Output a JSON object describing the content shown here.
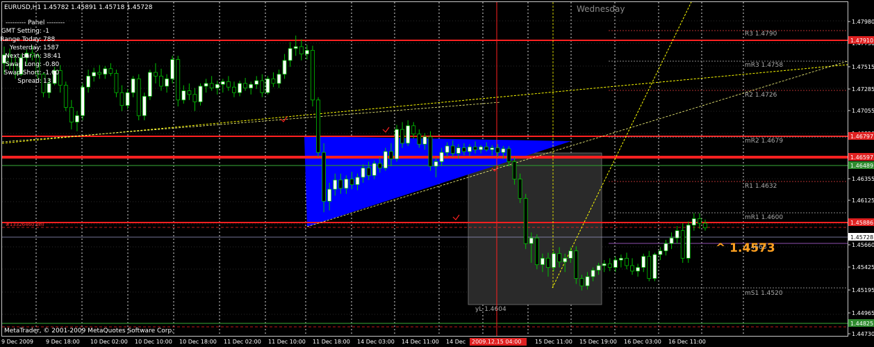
{
  "header": {
    "symbol_info": "EURUSD,H1  1.45782 1.45891 1.45718 1.45728",
    "day_label": "Wednesday"
  },
  "panel": {
    "title": "---------  Panel  --------",
    "rows": [
      {
        "label": "GMT Setting:",
        "value": "-1"
      },
      {
        "label": "Range Today:",
        "value": "788"
      },
      {
        "label": "Yesterday:",
        "value": "1587"
      },
      {
        "label": "Next bar in:",
        "value": "38:41"
      },
      {
        "label": "Swap Long:",
        "value": "-0.80"
      },
      {
        "label": "Swap Short:",
        "value": "-1.60"
      },
      {
        "label": "Spread:",
        "value": "13"
      }
    ]
  },
  "levels": [
    {
      "label": "R3 1.4790",
      "price": 1.479,
      "style": "dotted-red"
    },
    {
      "label": "mR3 1.4758",
      "price": 1.4758,
      "style": "dotted-gray"
    },
    {
      "label": "R2 1.4726",
      "price": 1.4726,
      "style": "dotted-red"
    },
    {
      "label": "mR2 1.4679",
      "price": 1.4679,
      "style": "dotted-gray"
    },
    {
      "label": "R1 1.4632",
      "price": 1.4632,
      "style": "dotted-red"
    },
    {
      "label": "mR1 1.4600",
      "price": 1.46,
      "style": "dotted-gray"
    },
    {
      "label": "1.4568",
      "price": 1.4568,
      "style": "solid-purple"
    },
    {
      "label": "mS1 1.4520",
      "price": 1.452,
      "style": "dotted-gray"
    }
  ],
  "price_axis": {
    "ticks": [
      "1.47980",
      "1.47750",
      "1.47515",
      "1.47285",
      "1.47055",
      "1.46820",
      "1.46585",
      "1.46355",
      "1.46125",
      "1.45890",
      "1.45660",
      "1.45425",
      "1.45195",
      "1.44965",
      "1.44730"
    ],
    "boxed": [
      {
        "label": "1.47910",
        "price": 1.4791,
        "color": "#e02020"
      },
      {
        "label": "1.46797",
        "price": 1.46797,
        "color": "#e02020"
      },
      {
        "label": "1.46597",
        "price": 1.46597,
        "color": "#e02020"
      },
      {
        "label": "1.46489",
        "price": 1.46489,
        "color": "#2e8b2e"
      },
      {
        "label": "1.45886",
        "price": 1.45886,
        "color": "#e02020"
      },
      {
        "label": "1.45728",
        "price": 1.45728,
        "color": "#ffffff"
      },
      {
        "label": "1.44825",
        "price": 1.44825,
        "color": "#2e8b2e"
      }
    ]
  },
  "time_axis": {
    "ticks": [
      "9 Dec 2009",
      "9 Dec 18:00",
      "10 Dec 02:00",
      "10 Dec 10:00",
      "10 Dec 18:00",
      "11 Dec 02:00",
      "11 Dec 10:00",
      "11 Dec 18:00",
      "14 Dec 03:00",
      "14 Dec 11:00",
      "14 Dec",
      "15 Dec 11:00",
      "15 Dec 19:00",
      "16 Dec 03:00",
      "16 Dec 11:00"
    ],
    "highlight": "2009.12.15 04:00"
  },
  "order_label": "#13326460 sell",
  "yl_label": "yL 1.4604",
  "big_price": "^ 1.4573",
  "footer": "MetaTrader, © 2001-2009 MetaQuotes Software Corp.",
  "colors": {
    "bull": "#ffffff",
    "bear": "#000000",
    "wick": "#00c000",
    "red_line": "#ff2020",
    "green_line": "#2e8b2e",
    "fill_blue": "#0000ff",
    "yellow": "#ffff00",
    "orange": "#ffa020"
  },
  "chart_data": {
    "type": "candlestick",
    "symbol": "EURUSD",
    "timeframe": "H1",
    "ylim": [
      1.4473,
      1.4798
    ],
    "candles": [
      [
        1.4752,
        1.477,
        1.474,
        1.4761
      ],
      [
        1.4761,
        1.4768,
        1.4745,
        1.475
      ],
      [
        1.475,
        1.476,
        1.4735,
        1.474
      ],
      [
        1.474,
        1.4762,
        1.4738,
        1.4758
      ],
      [
        1.4758,
        1.4767,
        1.475,
        1.4763
      ],
      [
        1.4763,
        1.4771,
        1.4755,
        1.476
      ],
      [
        1.476,
        1.4763,
        1.4735,
        1.474
      ],
      [
        1.474,
        1.4742,
        1.4715,
        1.472
      ],
      [
        1.472,
        1.4735,
        1.4714,
        1.473
      ],
      [
        1.473,
        1.4748,
        1.4728,
        1.4744
      ],
      [
        1.4744,
        1.475,
        1.472,
        1.4728
      ],
      [
        1.4728,
        1.4732,
        1.47,
        1.4704
      ],
      [
        1.4704,
        1.4712,
        1.468,
        1.4688
      ],
      [
        1.4688,
        1.47,
        1.4678,
        1.4695
      ],
      [
        1.4695,
        1.473,
        1.469,
        1.4726
      ],
      [
        1.4726,
        1.4745,
        1.472,
        1.4738
      ],
      [
        1.4738,
        1.4747,
        1.4732,
        1.4742
      ],
      [
        1.4742,
        1.475,
        1.4735,
        1.474
      ],
      [
        1.474,
        1.4749,
        1.4735,
        1.4746
      ],
      [
        1.4746,
        1.4752,
        1.4738,
        1.4741
      ],
      [
        1.4741,
        1.4745,
        1.4715,
        1.472
      ],
      [
        1.472,
        1.4728,
        1.47,
        1.4706
      ],
      [
        1.4706,
        1.4724,
        1.4702,
        1.472
      ],
      [
        1.472,
        1.4738,
        1.4715,
        1.4735
      ],
      [
        1.4735,
        1.474,
        1.469,
        1.4695
      ],
      [
        1.4695,
        1.472,
        1.469,
        1.4716
      ],
      [
        1.4716,
        1.4745,
        1.4712,
        1.4742
      ],
      [
        1.4742,
        1.4752,
        1.473,
        1.4738
      ],
      [
        1.4738,
        1.4746,
        1.4722,
        1.4727
      ],
      [
        1.4727,
        1.474,
        1.472,
        1.4735
      ],
      [
        1.4735,
        1.476,
        1.473,
        1.4756
      ],
      [
        1.4756,
        1.476,
        1.4705,
        1.4712
      ],
      [
        1.4712,
        1.4728,
        1.4708,
        1.4722
      ],
      [
        1.4722,
        1.473,
        1.4712,
        1.4718
      ],
      [
        1.4718,
        1.4725,
        1.47,
        1.471
      ],
      [
        1.471,
        1.473,
        1.4706,
        1.4727
      ],
      [
        1.4727,
        1.4735,
        1.472,
        1.473
      ],
      [
        1.473,
        1.4738,
        1.4722,
        1.4725
      ],
      [
        1.4725,
        1.4733,
        1.4718,
        1.4729
      ],
      [
        1.4729,
        1.4735,
        1.472,
        1.4732
      ],
      [
        1.4732,
        1.4738,
        1.4722,
        1.4726
      ],
      [
        1.4726,
        1.4732,
        1.4715,
        1.472
      ],
      [
        1.472,
        1.4733,
        1.4716,
        1.473
      ],
      [
        1.473,
        1.4736,
        1.4722,
        1.4725
      ],
      [
        1.4725,
        1.4732,
        1.4718,
        1.4729
      ],
      [
        1.4729,
        1.4738,
        1.4724,
        1.4733
      ],
      [
        1.4733,
        1.474,
        1.4715,
        1.472
      ],
      [
        1.472,
        1.4738,
        1.4718,
        1.4735
      ],
      [
        1.4735,
        1.4742,
        1.4726,
        1.473
      ],
      [
        1.473,
        1.4745,
        1.4725,
        1.474
      ],
      [
        1.474,
        1.4762,
        1.4735,
        1.4755
      ],
      [
        1.4755,
        1.4775,
        1.4748,
        1.4768
      ],
      [
        1.4768,
        1.4782,
        1.476,
        1.477
      ],
      [
        1.477,
        1.4778,
        1.4755,
        1.4762
      ],
      [
        1.4762,
        1.4772,
        1.4756,
        1.4766
      ],
      [
        1.4766,
        1.4771,
        1.4705,
        1.4712
      ],
      [
        1.4712,
        1.4715,
        1.465,
        1.4655
      ],
      [
        1.4655,
        1.4665,
        1.459,
        1.4602
      ],
      [
        1.4602,
        1.4622,
        1.4592,
        1.4615
      ],
      [
        1.4615,
        1.4632,
        1.4608,
        1.4625
      ],
      [
        1.4625,
        1.4632,
        1.461,
        1.4616
      ],
      [
        1.4616,
        1.463,
        1.461,
        1.4626
      ],
      [
        1.4626,
        1.4634,
        1.4615,
        1.462
      ],
      [
        1.462,
        1.4632,
        1.4614,
        1.4628
      ],
      [
        1.4628,
        1.4642,
        1.4622,
        1.4638
      ],
      [
        1.4638,
        1.4645,
        1.4625,
        1.463
      ],
      [
        1.463,
        1.4646,
        1.4626,
        1.4643
      ],
      [
        1.4643,
        1.465,
        1.4633,
        1.4638
      ],
      [
        1.4638,
        1.466,
        1.4635,
        1.4656
      ],
      [
        1.4656,
        1.4665,
        1.464,
        1.4648
      ],
      [
        1.4648,
        1.4685,
        1.4645,
        1.468
      ],
      [
        1.468,
        1.4688,
        1.466,
        1.4665
      ],
      [
        1.4665,
        1.469,
        1.4662,
        1.4684
      ],
      [
        1.4684,
        1.4688,
        1.467,
        1.4675
      ],
      [
        1.4675,
        1.468,
        1.466,
        1.4664
      ],
      [
        1.4664,
        1.4676,
        1.4658,
        1.4672
      ],
      [
        1.4672,
        1.4678,
        1.4635,
        1.464
      ],
      [
        1.464,
        1.465,
        1.4628,
        1.4645
      ],
      [
        1.4645,
        1.466,
        1.464,
        1.4655
      ],
      [
        1.4655,
        1.4666,
        1.465,
        1.4662
      ],
      [
        1.4662,
        1.4668,
        1.465,
        1.4654
      ],
      [
        1.4654,
        1.4664,
        1.4648,
        1.466
      ],
      [
        1.466,
        1.4665,
        1.4652,
        1.4656
      ],
      [
        1.4656,
        1.4664,
        1.4651,
        1.4661
      ],
      [
        1.4661,
        1.4667,
        1.4654,
        1.4658
      ],
      [
        1.4658,
        1.4663,
        1.4654,
        1.4661
      ],
      [
        1.4661,
        1.4666,
        1.4656,
        1.4658
      ],
      [
        1.4658,
        1.4663,
        1.4652,
        1.466
      ],
      [
        1.466,
        1.4664,
        1.465,
        1.4655
      ],
      [
        1.4655,
        1.4662,
        1.4648,
        1.4659
      ],
      [
        1.4659,
        1.4662,
        1.464,
        1.4645
      ],
      [
        1.4645,
        1.465,
        1.462,
        1.4626
      ],
      [
        1.4626,
        1.4632,
        1.46,
        1.4605
      ],
      [
        1.4605,
        1.461,
        1.455,
        1.4556
      ],
      [
        1.4556,
        1.4568,
        1.4535,
        1.4562
      ],
      [
        1.4562,
        1.4566,
        1.4528,
        1.4533
      ],
      [
        1.4533,
        1.4545,
        1.4525,
        1.454
      ],
      [
        1.454,
        1.4546,
        1.452,
        1.453
      ],
      [
        1.453,
        1.4548,
        1.4526,
        1.4545
      ],
      [
        1.4545,
        1.4552,
        1.453,
        1.4536
      ],
      [
        1.4536,
        1.4545,
        1.4525,
        1.454
      ],
      [
        1.454,
        1.4552,
        1.4535,
        1.4548
      ],
      [
        1.4548,
        1.4553,
        1.4512,
        1.4518
      ],
      [
        1.4518,
        1.4522,
        1.4505,
        1.451
      ],
      [
        1.451,
        1.4525,
        1.4506,
        1.452
      ],
      [
        1.452,
        1.453,
        1.4515,
        1.4527
      ],
      [
        1.4527,
        1.4535,
        1.4522,
        1.4532
      ],
      [
        1.4532,
        1.4538,
        1.4525,
        1.4534
      ],
      [
        1.4534,
        1.454,
        1.4526,
        1.453
      ],
      [
        1.453,
        1.4542,
        1.4525,
        1.4538
      ],
      [
        1.4538,
        1.4544,
        1.453,
        1.454
      ],
      [
        1.454,
        1.4546,
        1.4528,
        1.4532
      ],
      [
        1.4532,
        1.454,
        1.4522,
        1.4526
      ],
      [
        1.4526,
        1.4534,
        1.452,
        1.453
      ],
      [
        1.453,
        1.4545,
        1.4525,
        1.4542
      ],
      [
        1.4542,
        1.4548,
        1.4515,
        1.4518
      ],
      [
        1.4518,
        1.4546,
        1.4515,
        1.4544
      ],
      [
        1.4544,
        1.4552,
        1.4538,
        1.4548
      ],
      [
        1.4548,
        1.456,
        1.4543,
        1.4556
      ],
      [
        1.4556,
        1.4568,
        1.455,
        1.4562
      ],
      [
        1.4562,
        1.4575,
        1.4556,
        1.457
      ],
      [
        1.457,
        1.4578,
        1.4535,
        1.454
      ],
      [
        1.454,
        1.458,
        1.4535,
        1.4576
      ],
      [
        1.4576,
        1.4589,
        1.457,
        1.4583
      ],
      [
        1.4583,
        1.4589,
        1.4572,
        1.4578
      ],
      [
        1.4578,
        1.4582,
        1.457,
        1.4573
      ]
    ]
  }
}
